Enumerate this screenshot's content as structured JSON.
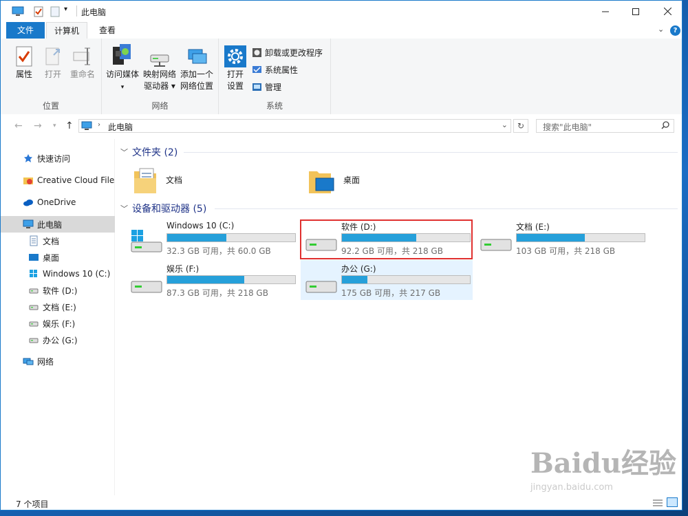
{
  "window": {
    "title": "此电脑"
  },
  "tabs": [
    {
      "label": "文件"
    },
    {
      "label": "计算机"
    },
    {
      "label": "查看"
    }
  ],
  "help": {
    "label": "?"
  },
  "ribbon": {
    "groups": [
      {
        "label": "位置",
        "buttons": [
          {
            "label": "属性"
          },
          {
            "label": "打开"
          },
          {
            "label": "重命名"
          }
        ]
      },
      {
        "label": "网络",
        "buttons": [
          {
            "label1": "访问媒体",
            "label2": ""
          },
          {
            "label1": "映射网络",
            "label2": "驱动器 ▾"
          },
          {
            "label1": "添加一个",
            "label2": "网络位置"
          }
        ]
      },
      {
        "label": "系统",
        "big": {
          "label1": "打开",
          "label2": "设置"
        },
        "small": [
          {
            "label": "卸载或更改程序"
          },
          {
            "label": "系统属性"
          },
          {
            "label": "管理"
          }
        ]
      }
    ]
  },
  "address": {
    "path": "此电脑",
    "search_placeholder": "搜索\"此电脑\""
  },
  "nav": {
    "items": [
      {
        "label": "快速访问"
      },
      {
        "label": "Creative Cloud Files"
      },
      {
        "label": "OneDrive"
      },
      {
        "label": "此电脑"
      },
      {
        "label": "文档"
      },
      {
        "label": "桌面"
      },
      {
        "label": "Windows 10 (C:)"
      },
      {
        "label": "软件 (D:)"
      },
      {
        "label": "文档 (E:)"
      },
      {
        "label": "娱乐 (F:)"
      },
      {
        "label": "办公 (G:)"
      },
      {
        "label": "网络"
      }
    ]
  },
  "sections": {
    "folders": "文件夹 (2)",
    "devices": "设备和驱动器 (5)"
  },
  "folders": [
    {
      "label": "文档"
    },
    {
      "label": "桌面"
    }
  ],
  "drives": [
    {
      "name": "Windows 10 (C:)",
      "size": "32.3 GB 可用，共 60.0 GB",
      "used_fraction": 0.46
    },
    {
      "name": "软件 (D:)",
      "size": "92.2 GB 可用，共 218 GB",
      "used_fraction": 0.58
    },
    {
      "name": "文档 (E:)",
      "size": "103 GB 可用，共 218 GB",
      "used_fraction": 0.53
    },
    {
      "name": "娱乐 (F:)",
      "size": "87.3 GB 可用，共 218 GB",
      "used_fraction": 0.6
    },
    {
      "name": "办公 (G:)",
      "size": "175 GB 可用，共 217 GB",
      "used_fraction": 0.2
    }
  ],
  "status": {
    "count": "7 个项目"
  },
  "watermark": {
    "brand": "Baidu经验",
    "url": "jingyan.baidu.com"
  }
}
